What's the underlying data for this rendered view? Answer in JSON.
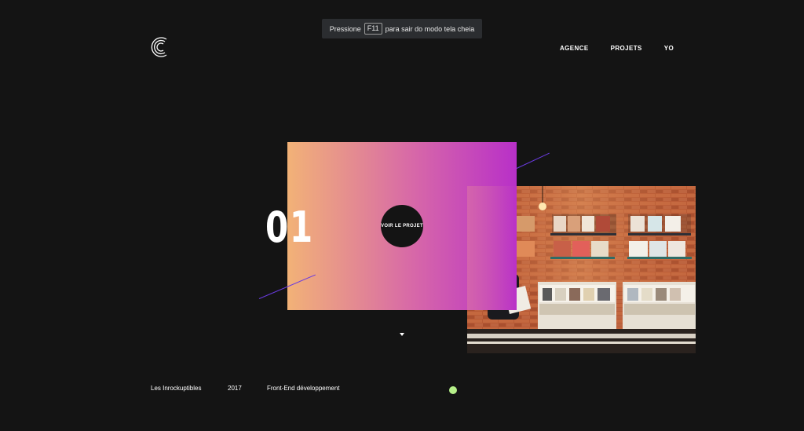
{
  "fullscreen_notice": {
    "prefix": "Pressione",
    "key": "F11",
    "suffix": "para sair do modo tela cheia"
  },
  "logo": {
    "icon": "logo-c-icon"
  },
  "nav": {
    "items": [
      {
        "label": "AGENCE"
      },
      {
        "label": "PROJETS"
      },
      {
        "label": "YO"
      }
    ]
  },
  "hero": {
    "number": "01",
    "cta_label": "VOIR LE PROJET",
    "gradient_colors": [
      "#f2b277",
      "#d768a8",
      "#b830c8"
    ],
    "accent_line_color": "#6a3be0",
    "photo": "record-store-photo"
  },
  "project": {
    "client": "Les Inrockuptibles",
    "year": "2017",
    "role": "Front-End développement",
    "indicator_color": "#b6f08a"
  }
}
